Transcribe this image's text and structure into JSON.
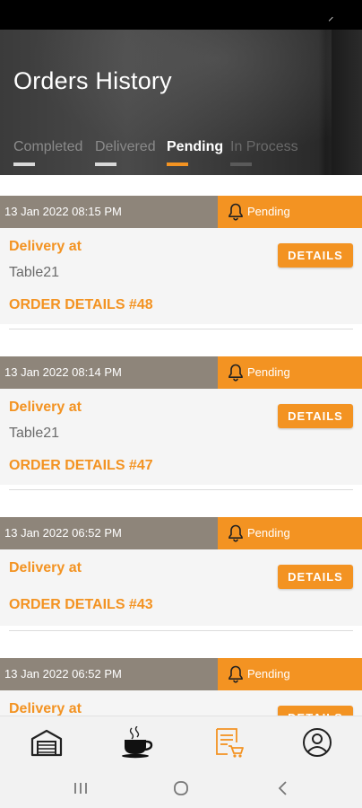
{
  "header": {
    "title": "Orders History"
  },
  "tabs": [
    {
      "label": "Completed",
      "active": false
    },
    {
      "label": "Delivered",
      "active": false
    },
    {
      "label": "Pending",
      "active": true
    },
    {
      "label": "In Process",
      "active": false
    }
  ],
  "orders": [
    {
      "datetime": "13 Jan 2022 08:15 PM",
      "status": "Pending",
      "delivery_label": "Delivery at",
      "table": "Table21",
      "order_label": "ORDER DETAILS #48",
      "details_label": "DETAILS"
    },
    {
      "datetime": "13 Jan 2022 08:14 PM",
      "status": "Pending",
      "delivery_label": "Delivery at",
      "table": "Table21",
      "order_label": "ORDER DETAILS #47",
      "details_label": "DETAILS"
    },
    {
      "datetime": "13 Jan 2022 06:52 PM",
      "status": "Pending",
      "delivery_label": "Delivery at",
      "table": "",
      "order_label": "ORDER DETAILS #43",
      "details_label": "DETAILS"
    },
    {
      "datetime": "13 Jan 2022 06:52 PM",
      "status": "Pending",
      "delivery_label": "Delivery at",
      "table": "",
      "order_label": "",
      "details_label": "DETAILS"
    }
  ],
  "bottom_nav": [
    {
      "icon": "garage-icon",
      "active": false
    },
    {
      "icon": "coffee-cup-icon",
      "active": false
    },
    {
      "icon": "order-receipt-icon",
      "active": true
    },
    {
      "icon": "profile-icon",
      "active": false
    }
  ],
  "colors": {
    "accent": "#f39322",
    "date_bar": "#8e857a",
    "inactive_icon": "#222222"
  }
}
